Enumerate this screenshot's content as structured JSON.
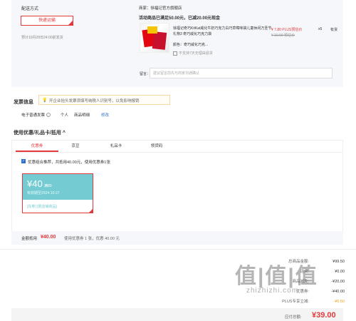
{
  "shipping": {
    "label": "配送方式",
    "option": "快递运输",
    "date": "预计10月28日24:00前发货"
  },
  "order": {
    "seller": "商家：徐福记官方旗舰店",
    "promo": "活动商品已满足50.00元，已减20.00元现金",
    "product_title": "徐福记奇巧KitKat威化牛奶巧克力白巧草莓味袋儿童休闲万圣节礼物3 奇巧威化巧克力袋",
    "price": "¥ 7.80 PLUS预估价",
    "orig_price": "¥ 19.90 预估价",
    "qty": "x5",
    "stock": "有货",
    "color": "颜色：奇巧威化巧克...",
    "service": "不支持7天无理由退货",
    "note_label": "留言：",
    "note_placeholder": "建议留言前先与商家沟通确认"
  },
  "invoice": {
    "title": "发票信息",
    "tip": "开企业抬头发票须填写纳税人识别号，以免影响报销",
    "type": "电子普通发票",
    "person": "个人",
    "detail": "商品明细",
    "modify": "修改"
  },
  "coupons": {
    "title": "使用优惠/礼品卡/抵用 ^",
    "tabs": [
      "优惠券",
      "京豆",
      "礼品卡",
      "领货码"
    ],
    "checkbox_text": "优惠组合推荐，共抵用40.00元，使用优惠券1张",
    "card": {
      "amount": "¥40",
      "condition": "满80",
      "expiry": "有效期至2024-10-27",
      "scope": "[东券] [限店铺商品]"
    },
    "summary_label": "金额抵用",
    "summary_value": "¥40.00",
    "summary_text": "使用优惠券 1 张，优惠 40.00 元"
  },
  "totals": {
    "rows": [
      {
        "k": "总商品金额:",
        "v": "¥99.50"
      },
      {
        "k": "运费:",
        "v": "¥0.00"
      },
      {
        "k": "商品减免:",
        "v": "-¥20.00"
      },
      {
        "k": "优惠券:",
        "v": "-¥40.00"
      },
      {
        "k": "PLUS专享立减:",
        "v": "-¥0.50"
      }
    ],
    "pay_label": "应付总额:",
    "pay_amount": "¥39.00"
  },
  "watermark": {
    "text": "值|值|值",
    "site": "zhizhizhi.com"
  },
  "colors": {
    "accent": "#e4393c",
    "coupon": "#74ccd2",
    "link": "#2d6ec6"
  }
}
